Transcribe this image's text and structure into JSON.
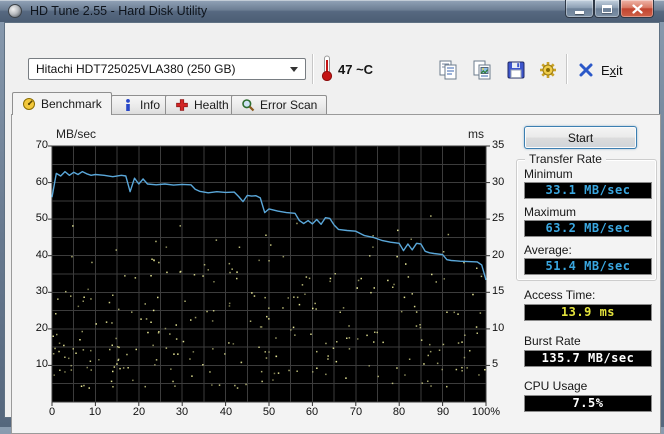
{
  "window": {
    "title": "HD Tune 2.55 - Hard Disk Utility"
  },
  "toolbar": {
    "drive_selector": "Hitachi HDT725025VLA380 (250 GB)",
    "temperature": "47 ~C",
    "exit": {
      "prefix": "E",
      "mnemonic": "x",
      "suffix": "it"
    }
  },
  "tabs": [
    {
      "label": "Benchmark",
      "active": true
    },
    {
      "label": "Info",
      "active": false
    },
    {
      "label": "Health",
      "active": false
    },
    {
      "label": "Error Scan",
      "active": false
    }
  ],
  "panel": {
    "start_button": "Start",
    "transfer_rate": {
      "group_label": "Transfer Rate",
      "minimum_label": "Minimum",
      "minimum_value": "33.1 MB/sec",
      "maximum_label": "Maximum",
      "maximum_value": "63.2 MB/sec",
      "average_label": "Average:",
      "average_value": "51.4 MB/sec"
    },
    "access_time_label": "Access Time:",
    "access_time_value": "13.9 ms",
    "burst_rate_label": "Burst Rate",
    "burst_rate_value": "135.7 MB/sec",
    "cpu_usage_label": "CPU Usage",
    "cpu_usage_value": "7.5%"
  },
  "chart_data": {
    "type": "line",
    "title": "HD Tune benchmark transfer rate and access time scatter",
    "x_axis": {
      "min": 0,
      "max": 100,
      "tick_labels": [
        "0",
        "10",
        "20",
        "30",
        "40",
        "50",
        "60",
        "70",
        "80",
        "90",
        "100%"
      ]
    },
    "left_axis": {
      "label": "MB/sec",
      "min": 0,
      "max": 70,
      "ticks": [
        70,
        60,
        50,
        40,
        30,
        20,
        10
      ]
    },
    "right_axis": {
      "label": "ms",
      "min": 0,
      "max": 35,
      "ticks": [
        35,
        30,
        25,
        20,
        15,
        10,
        5
      ]
    },
    "grid": {
      "x_step_percent": 5,
      "y_step_mbsec": 5,
      "color": "#3c3c3c",
      "background": "#000000"
    },
    "series": [
      {
        "name": "transfer_rate_mbsec",
        "type": "line",
        "color": "#5aa7d9",
        "x": [
          0,
          1,
          2,
          3,
          4,
          5,
          6,
          7,
          8,
          9,
          10,
          12,
          14,
          16,
          17,
          18,
          19,
          20,
          21,
          22,
          24,
          26,
          28,
          30,
          32,
          33,
          34,
          36,
          38,
          40,
          42,
          43,
          44,
          45,
          46,
          47,
          48,
          49,
          50,
          52,
          54,
          56,
          57,
          58,
          59,
          60,
          61,
          62,
          63,
          64,
          65,
          66,
          68,
          70,
          72,
          74,
          76,
          78,
          80,
          81,
          82,
          83,
          84,
          85,
          86,
          87,
          88,
          90,
          91,
          92,
          93,
          94,
          96,
          98,
          99,
          100
        ],
        "values": [
          56,
          62.5,
          61.8,
          63,
          62,
          62.8,
          62.2,
          63,
          62.4,
          62,
          62.2,
          62,
          61.6,
          62,
          61.8,
          57.5,
          61.2,
          59.6,
          61,
          59.6,
          59.4,
          59.6,
          59.3,
          59.5,
          59.4,
          58.2,
          57.6,
          57.2,
          57.5,
          57.3,
          57.4,
          56.2,
          54.8,
          56.5,
          56.3,
          56.4,
          55.8,
          51.8,
          52.8,
          52.2,
          51.8,
          51.6,
          49.6,
          48.8,
          49.6,
          48.7,
          49.9,
          48.6,
          50.4,
          50.2,
          48.4,
          47.2,
          46.9,
          46.7,
          45.5,
          45,
          44.2,
          43.7,
          43.4,
          41.4,
          43.2,
          41.6,
          43.4,
          43.2,
          41.2,
          40.8,
          40.6,
          40.3,
          38.9,
          38.7,
          38.6,
          38.5,
          38.4,
          38.3,
          37.5,
          33.4
        ]
      },
      {
        "name": "access_time_scatter",
        "type": "scatter",
        "color": "#efef9b",
        "count": 280,
        "seed": 12,
        "ms_range": [
          2,
          26
        ]
      }
    ]
  },
  "colors": {
    "value_cyan": "#3aa7e0",
    "value_yellow": "#e3e23c",
    "value_white": "#ffffff",
    "line_blue": "#5aa7d9",
    "scatter_yellow": "#efef9b",
    "chart_bg": "#000000",
    "grid": "#3c3c3c",
    "titlebar_blue": "#5a6b80",
    "close_red": "#c24530"
  }
}
